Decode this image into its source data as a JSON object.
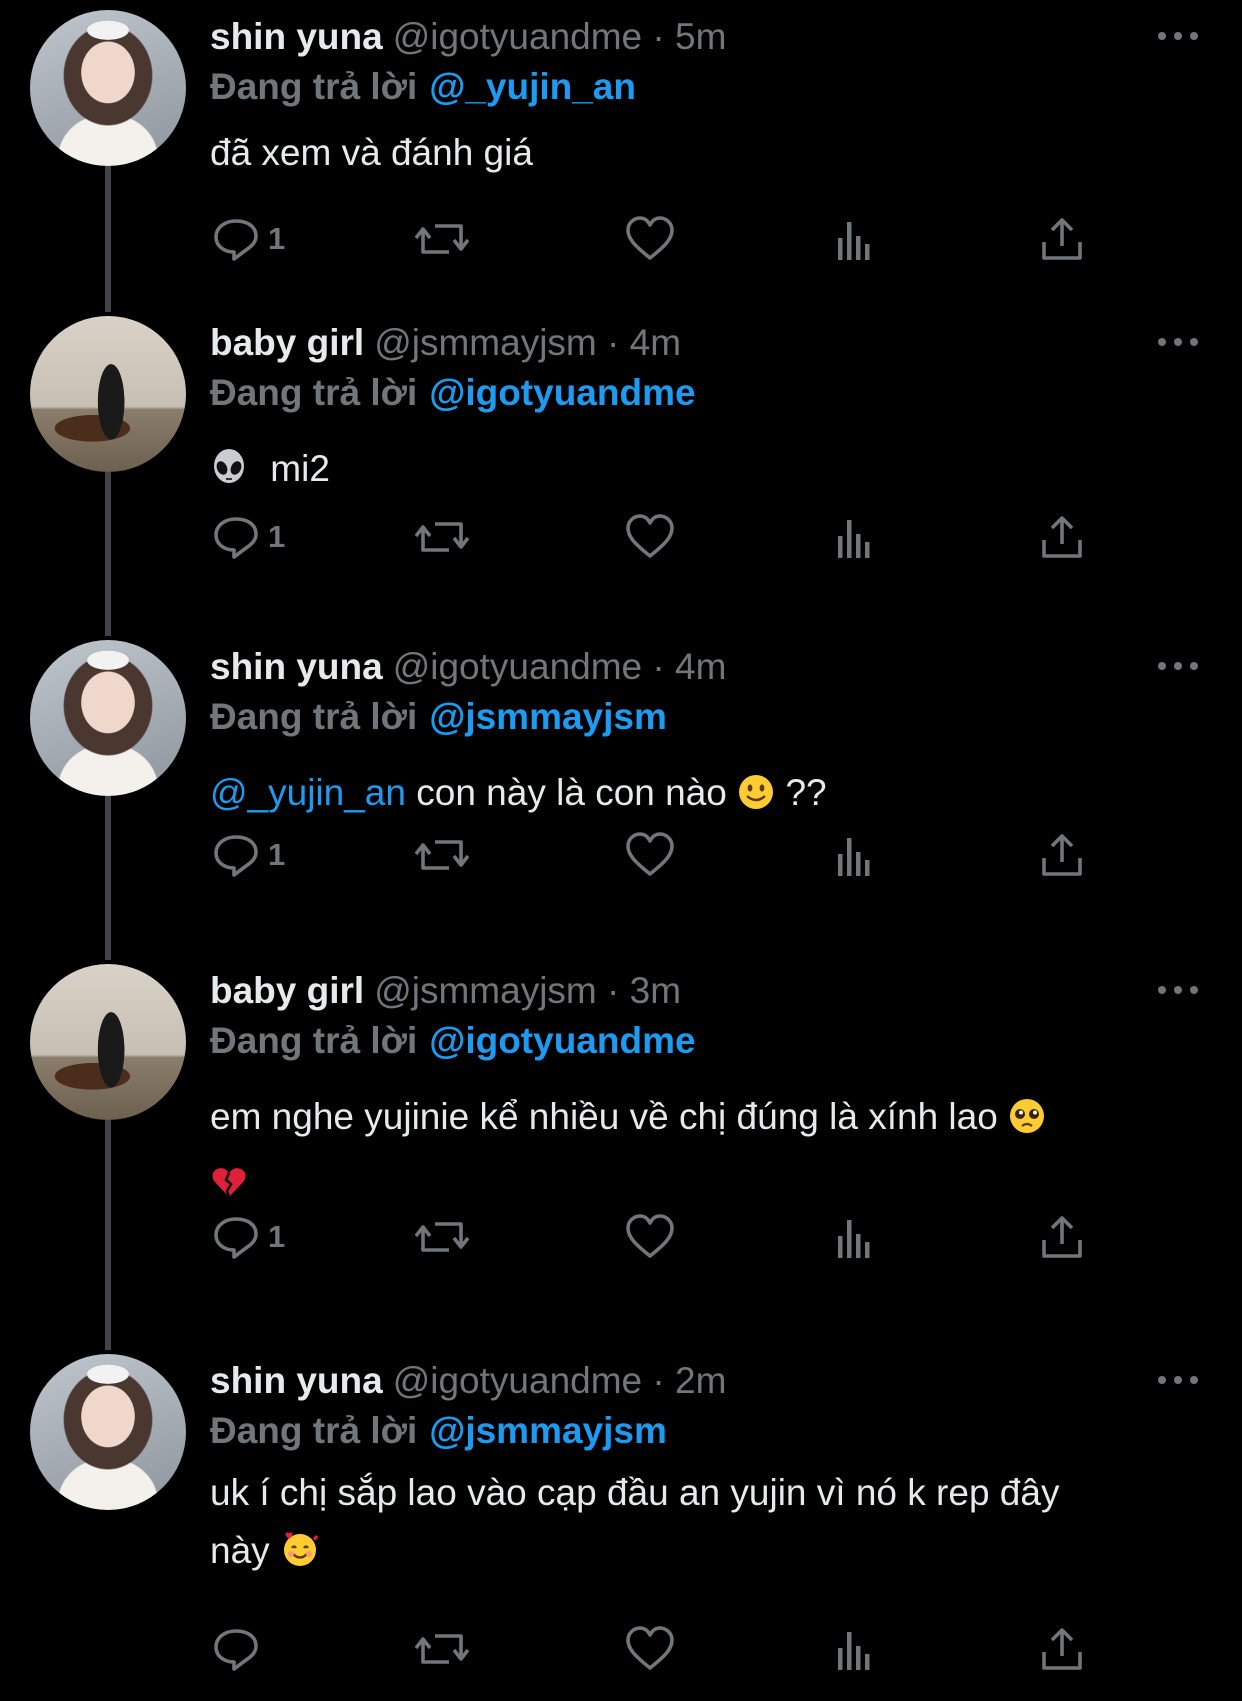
{
  "colors": {
    "background": "#000000",
    "text": "#e7e9ea",
    "muted": "#71767b",
    "accent": "#1d9bf0",
    "thread_line": "#404347"
  },
  "icons": {
    "reply": "reply-icon",
    "retweet": "retweet-icon",
    "like": "like-icon",
    "views": "views-icon",
    "share": "share-icon",
    "more": "more-icon"
  },
  "tweets": [
    {
      "name": "shin yuna",
      "handle": "@igotyuandme · 5m",
      "reply_prefix": "Đang trả lời",
      "reply_to": "@_yujin_an",
      "text": "đã xem và đánh giá",
      "reply_count": "1"
    },
    {
      "name": "baby girl",
      "handle": "@jsmmayjsm · 4m",
      "reply_prefix": "Đang trả lời",
      "reply_to": "@igotyuandme",
      "emoji": "alien",
      "text": "mi2",
      "reply_count": "1"
    },
    {
      "name": "shin yuna",
      "handle": "@igotyuandme · 4m",
      "reply_prefix": "Đang trả lời",
      "reply_to": "@jsmmayjsm",
      "mention": "@_yujin_an",
      "text": "con này là con nào",
      "emoji": "slightly-smiling",
      "text_end": "??",
      "reply_count": "1"
    },
    {
      "name": "baby girl",
      "handle": "@jsmmayjsm · 3m",
      "reply_prefix": "Đang trả lời",
      "reply_to": "@igotyuandme",
      "text": "em nghe yujinie kể nhiều về chị đúng là xính lao",
      "emoji": "pleading",
      "emoji_line2": "broken-heart",
      "reply_count": "1"
    },
    {
      "name": "shin yuna",
      "handle": "@igotyuandme · 2m",
      "reply_prefix": "Đang trả lời",
      "reply_to": "@jsmmayjsm",
      "text": "uk í chị sắp lao vào cạp đầu an yujin vì nó k rep đây",
      "text_line2": "này",
      "emoji": "smiling-hearts",
      "reply_count": ""
    }
  ]
}
